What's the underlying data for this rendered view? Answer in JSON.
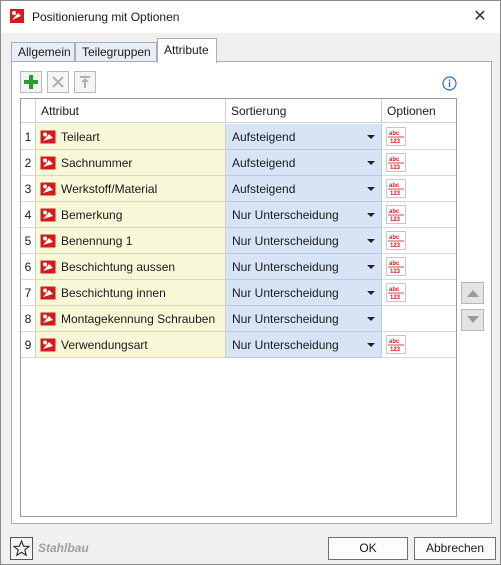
{
  "window": {
    "title": "Positionierung mit Optionen",
    "icons": {
      "app": "app-logo-icon",
      "close": "close-icon"
    }
  },
  "tabs": [
    "Allgemein",
    "Teilegruppen",
    "Attribute"
  ],
  "active_tab": "Attribute",
  "toolbar": {
    "add": "add-icon",
    "delete": "delete-icon",
    "up": "move-top-icon",
    "info": "info-icon"
  },
  "table": {
    "columns": [
      "Attribut",
      "Sortierung",
      "Optionen"
    ],
    "rows": [
      {
        "num": "1",
        "attribute": "Teileart",
        "sort": "Aufsteigend",
        "has_option": true
      },
      {
        "num": "2",
        "attribute": "Sachnummer",
        "sort": "Aufsteigend",
        "has_option": true
      },
      {
        "num": "3",
        "attribute": "Werkstoff/Material",
        "sort": "Aufsteigend",
        "has_option": true
      },
      {
        "num": "4",
        "attribute": "Bemerkung",
        "sort": "Nur Unterscheidung",
        "has_option": true
      },
      {
        "num": "5",
        "attribute": "Benennung 1",
        "sort": "Nur Unterscheidung",
        "has_option": true
      },
      {
        "num": "6",
        "attribute": "Beschichtung aussen",
        "sort": "Nur Unterscheidung",
        "has_option": true
      },
      {
        "num": "7",
        "attribute": "Beschichtung innen",
        "sort": "Nur Unterscheidung",
        "has_option": true
      },
      {
        "num": "8",
        "attribute": "Montagekennung Schrauben",
        "sort": "Nur Unterscheidung",
        "has_option": false
      },
      {
        "num": "9",
        "attribute": "Verwendungsart",
        "sort": "Nur Unterscheidung",
        "has_option": true
      }
    ]
  },
  "side_buttons": {
    "up": "arrow-up-icon",
    "down": "arrow-down-icon"
  },
  "footer": {
    "favorite_icon": "star-icon",
    "profile": "Stahlbau",
    "ok": "OK",
    "cancel": "Abbrechen"
  },
  "colors": {
    "attribute_cell": "#f8f8d8",
    "sort_cell": "#d6e4f5",
    "brand_red": "#d21c1c"
  }
}
